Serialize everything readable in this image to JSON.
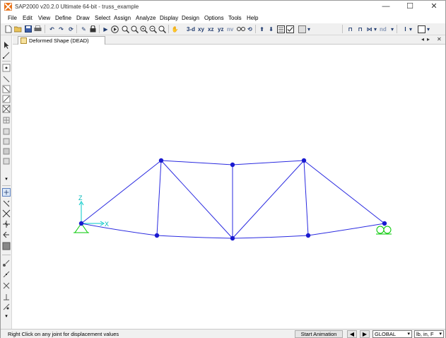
{
  "window": {
    "title": "SAP2000 v20.2.0 Ultimate 64-bit - truss_example",
    "controls": {
      "minimize": "—",
      "maximize": "☐",
      "close": "✕"
    }
  },
  "menu": [
    "File",
    "Edit",
    "View",
    "Define",
    "Draw",
    "Select",
    "Assign",
    "Analyze",
    "Display",
    "Design",
    "Options",
    "Tools",
    "Help"
  ],
  "toolbar": {
    "view_3d": "3-d",
    "view_xy": "xy",
    "view_xz": "xz",
    "view_yz": "yz",
    "view_nv": "nv",
    "design_nd": "nd"
  },
  "tab": {
    "label": "Deformed Shape (DEAD)",
    "nav_left": "◂",
    "nav_right": "▸",
    "close": "✕"
  },
  "axes": {
    "z_label": "Z",
    "x_label": "X"
  },
  "truss": {
    "joints": [
      {
        "id": "support-left",
        "support": "pin"
      },
      {
        "id": "top-1"
      },
      {
        "id": "top-2"
      },
      {
        "id": "top-3"
      },
      {
        "id": "support-right",
        "support": "roller"
      },
      {
        "id": "bottom-1"
      },
      {
        "id": "bottom-2"
      },
      {
        "id": "bottom-3"
      }
    ],
    "colors": {
      "frame": "#2a2ae0",
      "joint": "#1a1ad0",
      "axes": "#00cccc",
      "support": "#00cc00"
    }
  },
  "status": {
    "message": "Right Click on any joint for displacement values",
    "start_animation": "Start Animation",
    "prev": "◀",
    "next": "▶",
    "coord_system": "GLOBAL",
    "units": "lb, in, F"
  }
}
